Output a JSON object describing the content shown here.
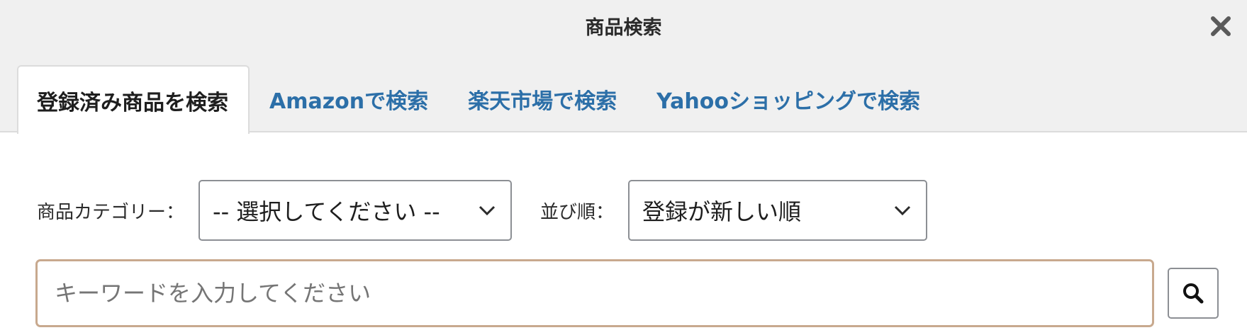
{
  "dialog": {
    "title": "商品検索",
    "close_icon": "close-icon"
  },
  "tabs": [
    {
      "label": "登録済み商品を検索",
      "active": true
    },
    {
      "label": "Amazonで検索",
      "active": false
    },
    {
      "label": "楽天市場で検索",
      "active": false
    },
    {
      "label": "Yahooショッピングで検索",
      "active": false
    }
  ],
  "filters": {
    "category_label": "商品カテゴリー：",
    "category_value": "-- 選択してください --",
    "sort_label": "並び順：",
    "sort_value": "登録が新しい順"
  },
  "search": {
    "placeholder": "キーワードを入力してください",
    "value": "",
    "button_icon": "search-icon"
  },
  "colors": {
    "tab_link": "#2c6fa8",
    "header_bg": "#f0f0f0",
    "input_border": "#c8a98e"
  }
}
